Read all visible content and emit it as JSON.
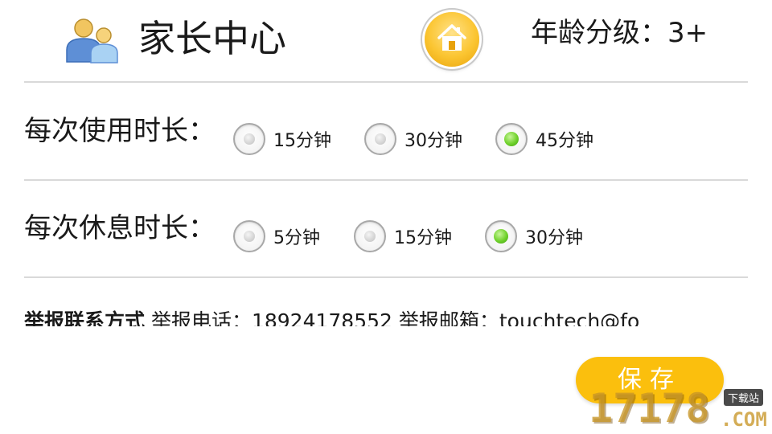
{
  "header": {
    "title": "家长中心",
    "age_rating": "年龄分级：3+",
    "icons": {
      "parents": "parents-icon",
      "home": "home-icon"
    }
  },
  "usage_duration": {
    "label": "每次使用时长：",
    "options": [
      {
        "label": "15分钟",
        "selected": false
      },
      {
        "label": "30分钟",
        "selected": false
      },
      {
        "label": "45分钟",
        "selected": true
      }
    ]
  },
  "rest_duration": {
    "label": "每次休息时长：",
    "options": [
      {
        "label": "5分钟",
        "selected": false
      },
      {
        "label": "15分钟",
        "selected": false
      },
      {
        "label": "30分钟",
        "selected": true
      }
    ]
  },
  "contact": {
    "label": "举报联系方式",
    "text": " 举报电话：18924178552 举报邮箱：touchtech@fo"
  },
  "save_label": "保存",
  "watermark": {
    "number": "17178",
    "badge": "下载站",
    "domain": ".COM"
  },
  "colors": {
    "accent": "#fbbf0d",
    "radio_selected": "#6fd12b",
    "divider": "#d9d9d9"
  }
}
